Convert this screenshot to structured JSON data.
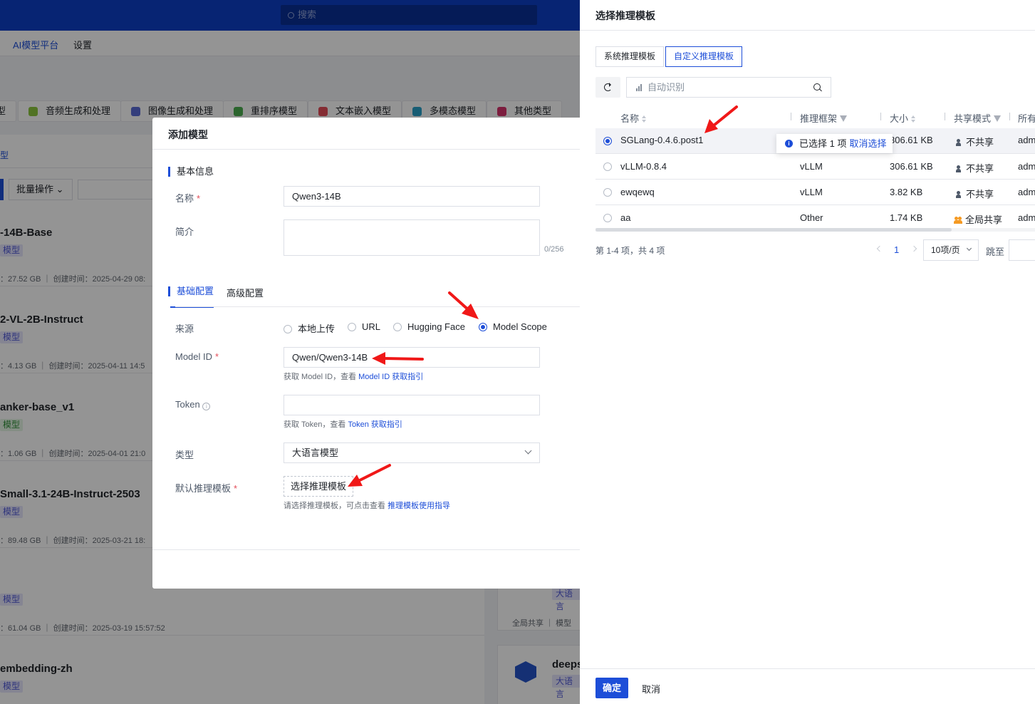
{
  "app": {
    "search_placeholder": "搜索",
    "nav": [
      "AI模型平台",
      "设置"
    ]
  },
  "categories": [
    "型",
    "音频生成和处理",
    "图像生成和处理",
    "重排序模型",
    "文本嵌入模型",
    "多模态模型",
    "其他类型"
  ],
  "category_icon_colors": [
    "#7a8ba6",
    "#8cc63f",
    "#5b6bd6",
    "#4caf50",
    "#e34d59",
    "#29a0c8",
    "#d6336c"
  ],
  "list": {
    "tab": "型",
    "batch_label": "批量操作",
    "models": [
      {
        "name": "-14B-Base",
        "tag": "模型",
        "meta": "：27.52 GB ｜ 创建时间：2025-04-29 08:"
      },
      {
        "name": "2-VL-2B-Instruct",
        "tag": "模型",
        "meta": "：4.13 GB ｜ 创建时间：2025-04-11 14:5"
      },
      {
        "name": "anker-base_v1",
        "tag": "模型",
        "meta": "：1.06 GB ｜ 创建时间：2025-04-01 21:0"
      },
      {
        "name": "Small-3.1-24B-Instruct-2503",
        "tag": "模型",
        "meta": "：89.48 GB ｜ 创建时间：2025-03-21 18:"
      },
      {
        "name": "",
        "tag": "模型",
        "meta": "：61.04 GB ｜ 创建时间：2025-03-19 15:57:52"
      },
      {
        "name": "embedding-zh",
        "tag": "模型",
        "meta": ""
      }
    ],
    "right_cards": [
      {
        "name": "",
        "tag": "大语言",
        "meta": "全局共享 ｜ 模型"
      },
      {
        "name": "deeps",
        "tag": "大语言",
        "meta": ""
      }
    ]
  },
  "dialog": {
    "title": "添加模型",
    "basic_section": "基本信息",
    "name_label": "名称",
    "name_value": "Qwen3-14B",
    "desc_label": "简介",
    "desc_counter": "0/256",
    "tabs": [
      "基础配置",
      "高级配置"
    ],
    "source_label": "来源",
    "source_options": [
      "本地上传",
      "URL",
      "Hugging Face",
      "Model Scope"
    ],
    "model_id_label": "Model ID",
    "model_id_value": "Qwen/Qwen3-14B",
    "model_id_help": "获取 Model ID，查看",
    "model_id_link": "Model ID 获取指引",
    "token_label": "Token",
    "token_help": "获取 Token，查看",
    "token_link": "Token 获取指引",
    "type_label": "类型",
    "type_value": "大语言模型",
    "template_label": "默认推理模板",
    "template_button": "选择推理模板",
    "template_help": "请选择推理模板，可点击查看",
    "template_link": "推理模板使用指导"
  },
  "drawer": {
    "title": "选择推理模板",
    "tabs": [
      "系统推理模板",
      "自定义推理模板"
    ],
    "search_placeholder": "自动识别",
    "columns": [
      "名称",
      "推理框架",
      "大小",
      "共享模式",
      "所有"
    ],
    "rows": [
      {
        "name": "SGLang-0.4.6.post1",
        "framework": "",
        "size": "306.61 KB",
        "share": "不共享",
        "owner": "adm",
        "selected": true
      },
      {
        "name": "vLLM-0.8.4",
        "framework": "vLLM",
        "size": "306.61 KB",
        "share": "不共享",
        "owner": "adm",
        "selected": false
      },
      {
        "name": "ewqewq",
        "framework": "vLLM",
        "size": "3.82 KB",
        "share": "不共享",
        "owner": "adm",
        "selected": false
      },
      {
        "name": "aa",
        "framework": "Other",
        "size": "1.74 KB",
        "share": "全局共享",
        "owner": "adm",
        "selected": false
      }
    ],
    "selection_tooltip": "已选择 1 项",
    "selection_cancel": "取消选择",
    "pager_total": "第 1-4 项，共 4 项",
    "current_page": "1",
    "page_size": "10项/页",
    "jump_label": "跳至",
    "ok": "确定",
    "cancel": "取消"
  },
  "colors": {
    "brand": "#1d4ed8",
    "topbar": "#0d3ec7",
    "annotation": "#f01818"
  }
}
